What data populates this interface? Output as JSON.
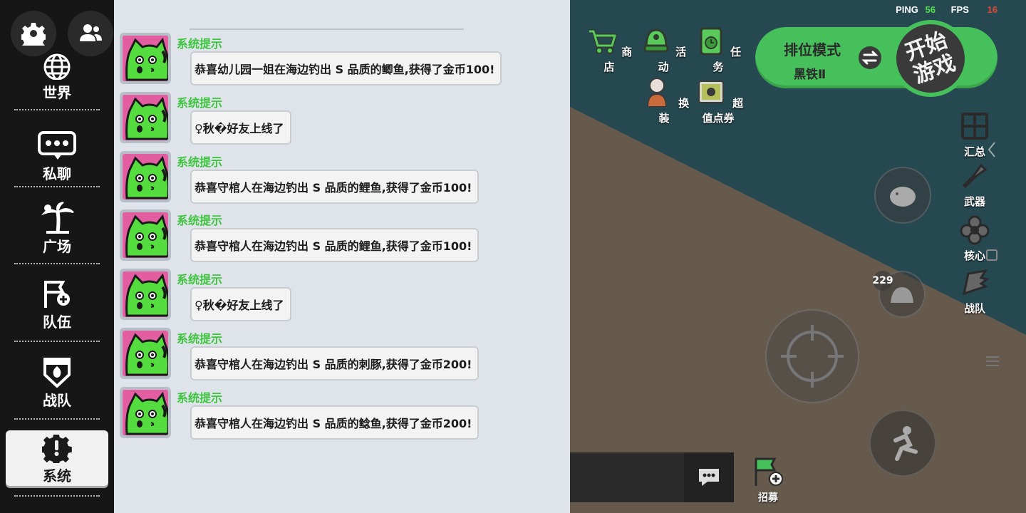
{
  "hud": {
    "ping_label": "PING",
    "ping_value": "56",
    "fps_label": "FPS",
    "fps_value": "16"
  },
  "top_menu": {
    "shop": "商店",
    "activity": "活动",
    "task": "任务",
    "outfit": "换装",
    "voucher": "超值点券"
  },
  "mode": {
    "mode_label": "排位模式",
    "rank_label": "黑铁Ⅱ",
    "start_label": "开始游戏"
  },
  "side_menu": {
    "summary": "汇总",
    "weapon": "武器",
    "core": "核心",
    "squad": "战队"
  },
  "badge_count": "229",
  "recruit_label": "招募",
  "nav": [
    {
      "label": "世界",
      "icon": "globe-icon"
    },
    {
      "label": "私聊",
      "icon": "chat-bubble-icon"
    },
    {
      "label": "广场",
      "icon": "palm-tree-icon"
    },
    {
      "label": "队伍",
      "icon": "flag-plus-icon"
    },
    {
      "label": "战队",
      "icon": "shield-crest-icon"
    },
    {
      "label": "系统",
      "icon": "alert-gear-icon"
    }
  ],
  "messages": [
    {
      "sender": "系统提示",
      "text": "恭喜幼儿园一姐在海边钓出 S 品质的鲫鱼,获得了金币100!"
    },
    {
      "sender": "系统提示",
      "text": "♀秋�好友上线了"
    },
    {
      "sender": "系统提示",
      "text": "恭喜守棺人在海边钓出 S 品质的鲤鱼,获得了金币100!"
    },
    {
      "sender": "系统提示",
      "text": "恭喜守棺人在海边钓出 S 品质的鲤鱼,获得了金币100!"
    },
    {
      "sender": "系统提示",
      "text": "♀秋�好友上线了"
    },
    {
      "sender": "系统提示",
      "text": "恭喜守棺人在海边钓出 S 品质的刺豚,获得了金币200!"
    },
    {
      "sender": "系统提示",
      "text": "恭喜守棺人在海边钓出 S 品质的鲶鱼,获得了金币200!"
    }
  ],
  "colors": {
    "sender_green": "#3ec43e",
    "mode_green": "#46c05a",
    "avatar_pink": "#e25ea1",
    "cat_green": "#55dd3f"
  }
}
